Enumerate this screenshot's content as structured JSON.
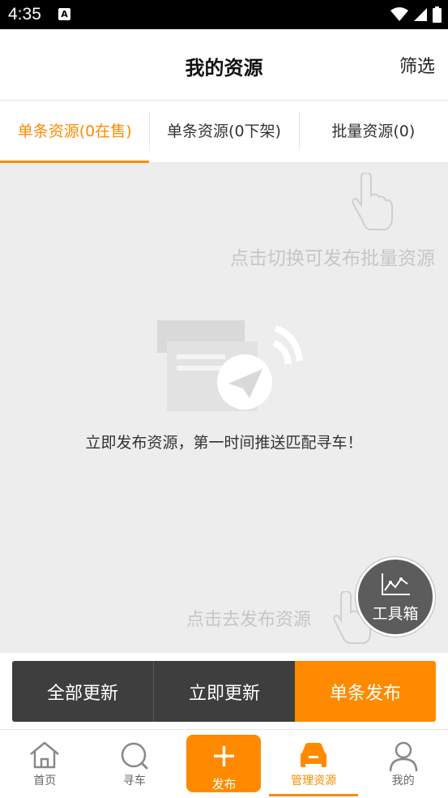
{
  "status_bar": {
    "time": "4:35",
    "notification_badge": "A"
  },
  "header": {
    "title": "我的资源",
    "filter_label": "筛选"
  },
  "tabs": [
    {
      "label": "单条资源(0在售)",
      "active": true
    },
    {
      "label": "单条资源(0下架)",
      "active": false
    },
    {
      "label": "批量资源(0)",
      "active": false
    }
  ],
  "content": {
    "hint_top": "点击切换可发布批量资源",
    "empty_message": "立即发布资源，第一时间推送匹配寻车！",
    "hint_bottom": "点击去发布资源"
  },
  "toolbox": {
    "label": "工具箱"
  },
  "actions": {
    "update_all": "全部更新",
    "update_now": "立即更新",
    "publish_single": "单条发布"
  },
  "bottom_nav": {
    "home": "首页",
    "find_car": "寻车",
    "publish": "发布",
    "manage": "管理资源",
    "mine": "我的"
  },
  "colors": {
    "accent": "#ff8a00",
    "dark_button": "#3e3e3e",
    "background": "#ededed"
  }
}
